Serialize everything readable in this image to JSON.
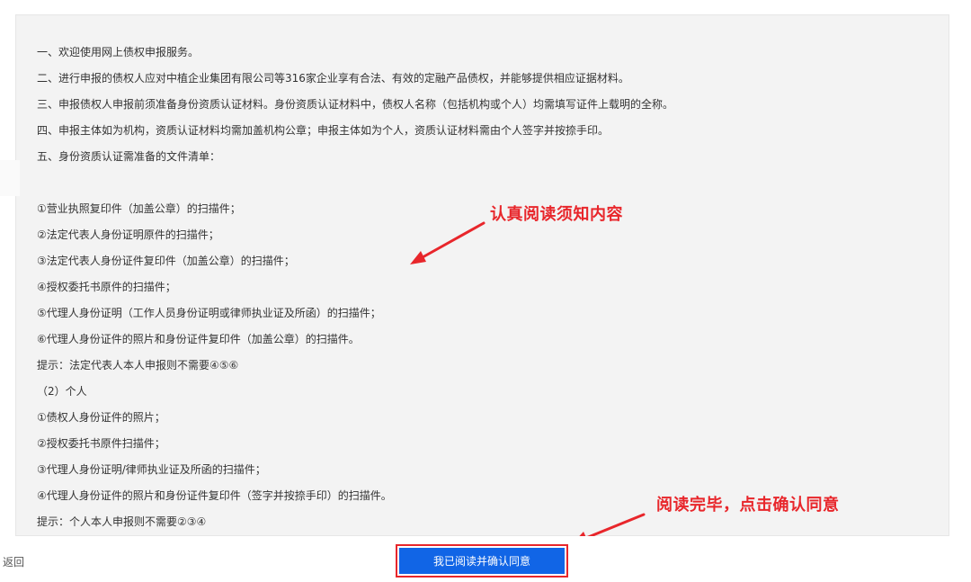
{
  "notice": {
    "lines": [
      "一、欢迎使用网上债权申报服务。",
      "二、进行申报的债权人应对中植企业集团有限公司等316家企业享有合法、有效的定融产品债权，并能够提供相应证据材料。",
      "三、申报债权人申报前须准备身份资质认证材料。身份资质认证材料中，债权人名称（包括机构或个人）均需填写证件上载明的全称。",
      "四、申报主体如为机构，资质认证材料均需加盖机构公章；申报主体如为个人，资质认证材料需由个人签字并按捺手印。",
      "五、身份资质认证需准备的文件清单：",
      "①营业执照复印件（加盖公章）的扫描件；",
      "②法定代表人身份证明原件的扫描件；",
      "③法定代表人身份证件复印件（加盖公章）的扫描件；",
      "④授权委托书原件的扫描件；",
      "⑤代理人身份证明（工作人员身份证明或律师执业证及所函）的扫描件；",
      "⑥代理人身份证件的照片和身份证件复印件（加盖公章）的扫描件。",
      "提示：法定代表人本人申报则不需要④⑤⑥",
      "（2）个人",
      "①债权人身份证件的照片；",
      "②授权委托书原件扫描件；",
      "③代理人身份证明/律师执业证及所函的扫描件；",
      "④代理人身份证件的照片和身份证件复印件（签字并按捺手印）的扫描件。",
      "提示：个人本人申报则不需要②③④"
    ]
  },
  "annotations": {
    "read_notice": "认真阅读须知内容",
    "after_reading": "阅读完毕，点击确认同意"
  },
  "footer": {
    "back_label": "返回",
    "confirm_label": "我已阅读并确认同意"
  },
  "colors": {
    "annotation": "#e8262b",
    "button": "#1165e6",
    "panel": "#f3f3f3"
  }
}
